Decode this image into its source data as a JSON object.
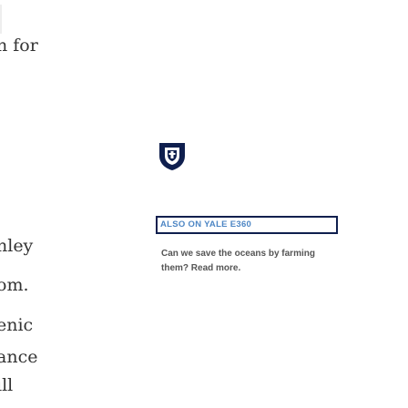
{
  "left_column": {
    "fragments": [
      "n for",
      "nley",
      "om.",
      "enic",
      "ance",
      "ill"
    ]
  },
  "logo": {
    "icon": "yale-shield-icon",
    "colors": {
      "shield": "#0f1f4e",
      "emblem": "#ffffff"
    }
  },
  "tag": {
    "label": "ALSO ON YALE E360",
    "border_color": "#0f1f4e",
    "text_color": "#4d86c4"
  },
  "teaser": {
    "text": "Can we save the oceans by farming them?",
    "link_label": "Read more."
  }
}
